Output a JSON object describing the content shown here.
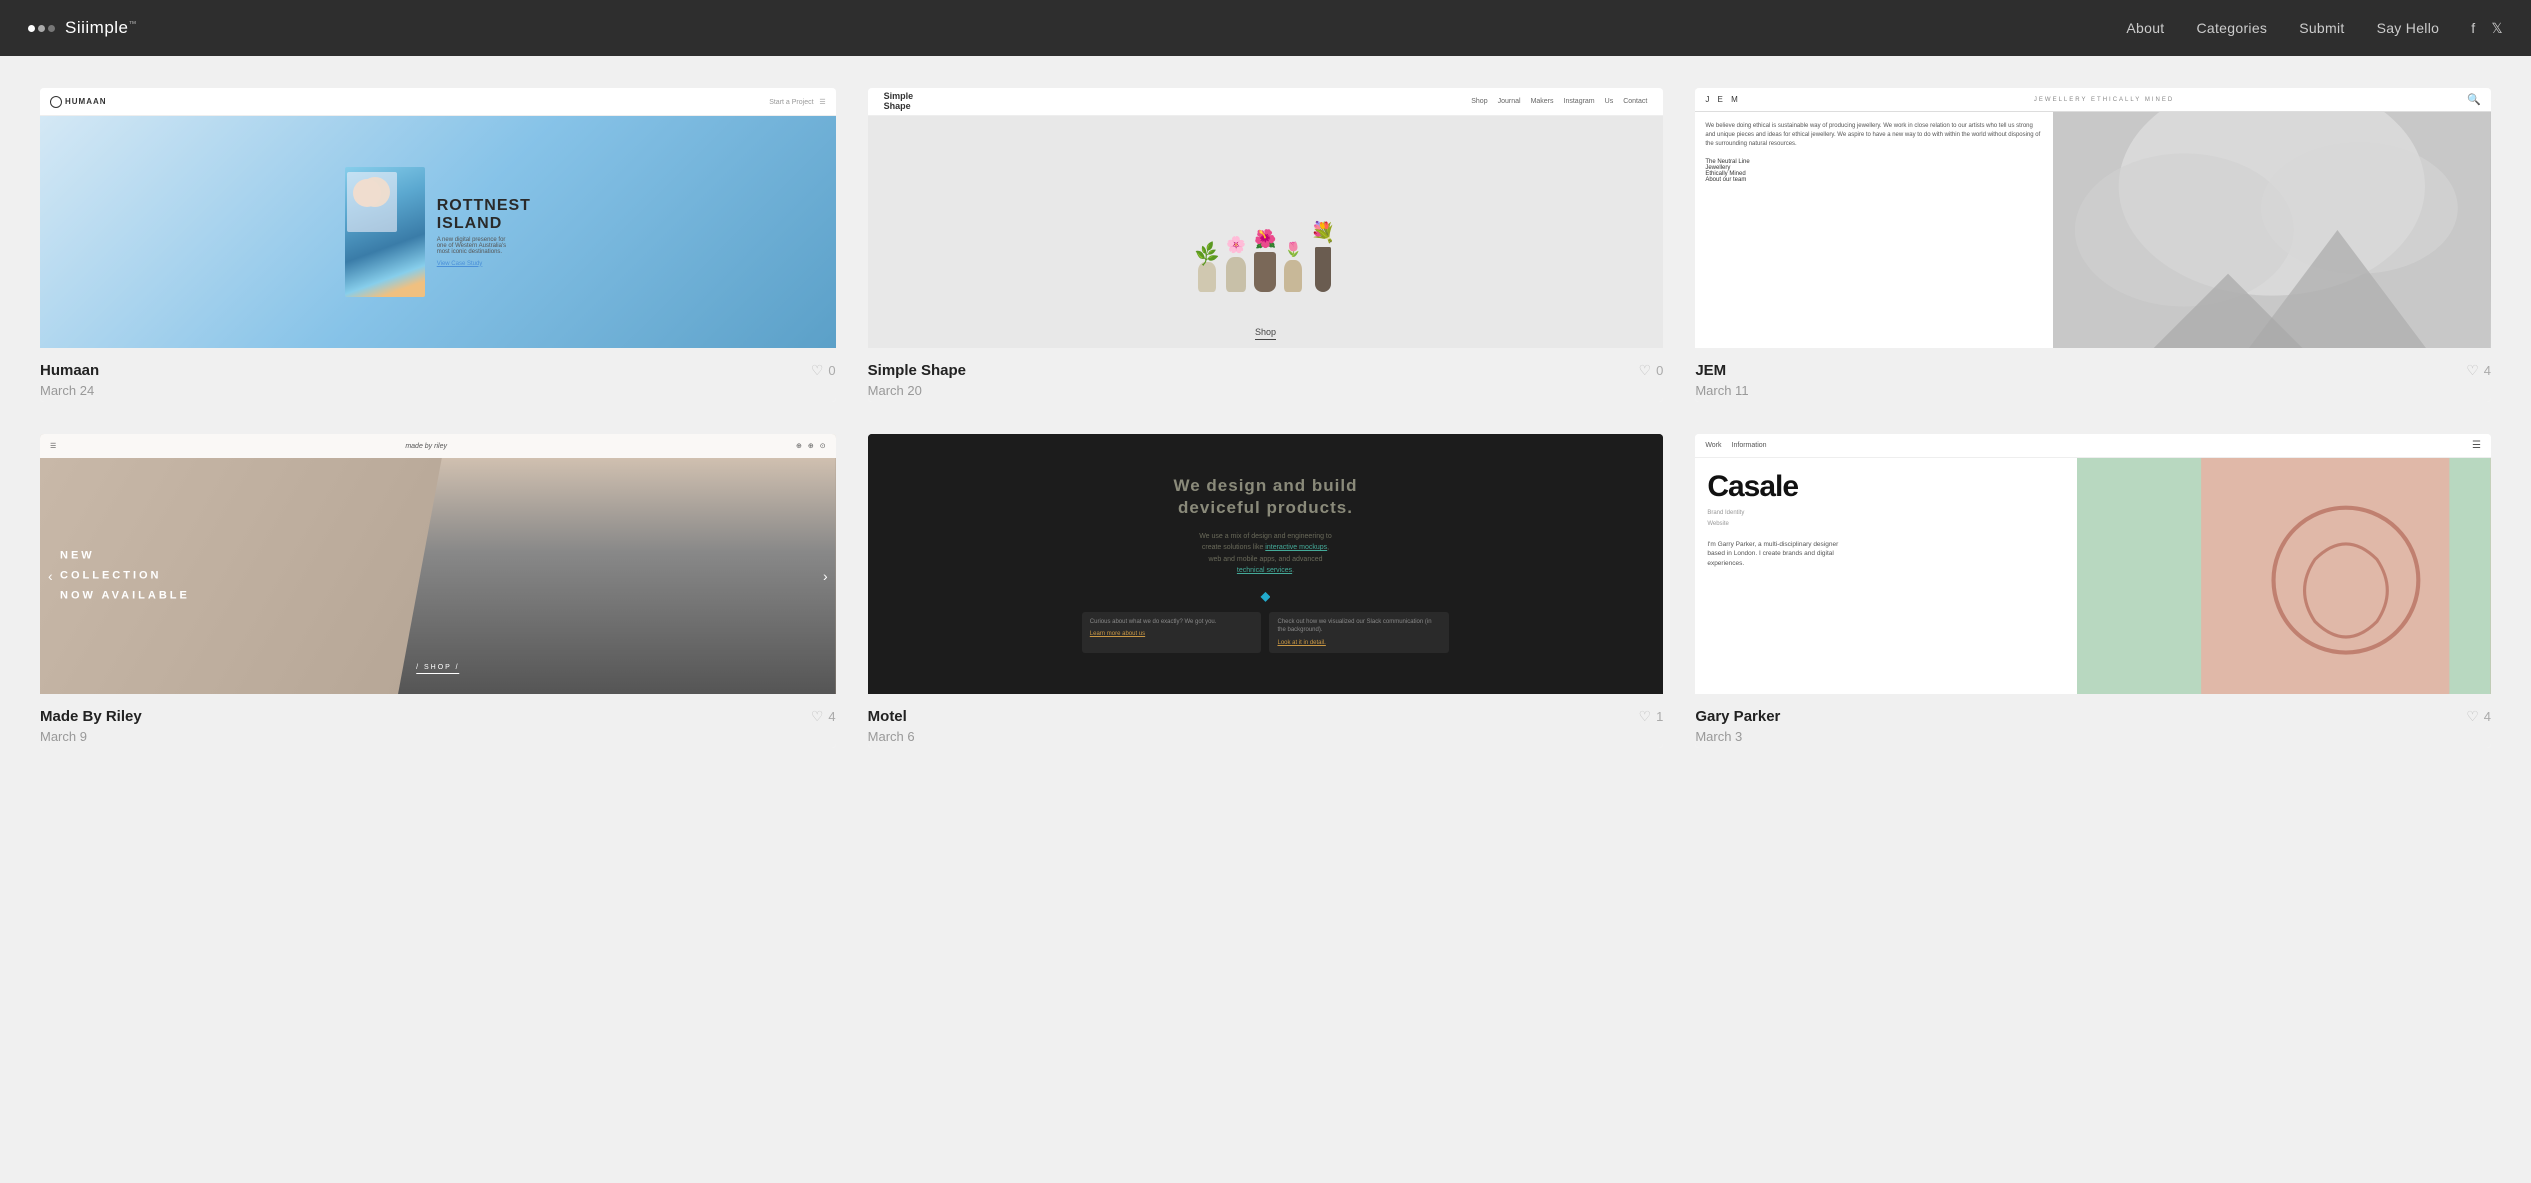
{
  "header": {
    "logo_text": "Siiimple",
    "logo_tm": "™",
    "nav": {
      "about": "About",
      "categories": "Categories",
      "submit": "Submit",
      "say_hello": "Say Hello"
    },
    "social": {
      "facebook": "f",
      "twitter": "🐦"
    }
  },
  "cards": [
    {
      "id": "humaan",
      "title": "Humaan",
      "date": "March 24",
      "likes": "0",
      "mock": {
        "logo": "HUMAAN",
        "nav_right": "Start a Project",
        "hero_title": "ROTTNEST\nISLAND",
        "hero_subtitle": "A new digital presence for one of Western Australia's most iconic destinations.",
        "hero_link": "View Case Study"
      }
    },
    {
      "id": "simple-shape",
      "title": "Simple Shape",
      "date": "March 20",
      "likes": "0",
      "mock": {
        "logo": "Simple\nShape",
        "nav": [
          "Shop",
          "Journal",
          "Makers",
          "Instagram",
          "Us",
          "Contact"
        ],
        "shop_label": "Shop"
      }
    },
    {
      "id": "jem",
      "title": "JEM",
      "date": "March 11",
      "likes": "4",
      "mock": {
        "logo": "J E M",
        "tagline": "JEWELLERY ETHICALLY MINED",
        "left_text": "We believe doing ethical is sustainable way of\nproducing jewellery. We work in close relation to\nour artists who tell us strong and unique pieces\nand ideas for ethical jewellery. We aspire to\nhave a new way to do with within the world\nwithout disposing of the surrounding natural\nresources."
      }
    },
    {
      "id": "made-by-riley",
      "title": "Made By Riley",
      "date": "March 9",
      "likes": "4",
      "mock": {
        "brand": "made by riley",
        "headline": "NEW\nCOLLECTION\nNOW AVAILABLE",
        "cta": "/ SHOP /"
      }
    },
    {
      "id": "motel",
      "title": "Motel",
      "date": "March 6",
      "likes": "1",
      "mock": {
        "headline": "We design and build\ndeviceful products.",
        "sub": "We use a mix of design and engineering to create solutions like interactive mockups, web and mobile apps, and advanced technical services.",
        "card1_title": "Curious about what we do exactly? We got you.",
        "card1_link": "Learn more about us",
        "card2_title": "Check out how we visualized our Slack communication (in the background).",
        "card2_link": "Look at it in detail."
      }
    },
    {
      "id": "gary-parker",
      "title": "Gary Parker",
      "date": "March 3",
      "likes": "4",
      "mock": {
        "nav_left": "Work   Information",
        "brand": "Casale",
        "labels": "Brand Identity\nWebsite",
        "bio": "I'm Garry Parker, a multi-disciplinary designer based in London. I create brands and digital experiences."
      }
    }
  ]
}
